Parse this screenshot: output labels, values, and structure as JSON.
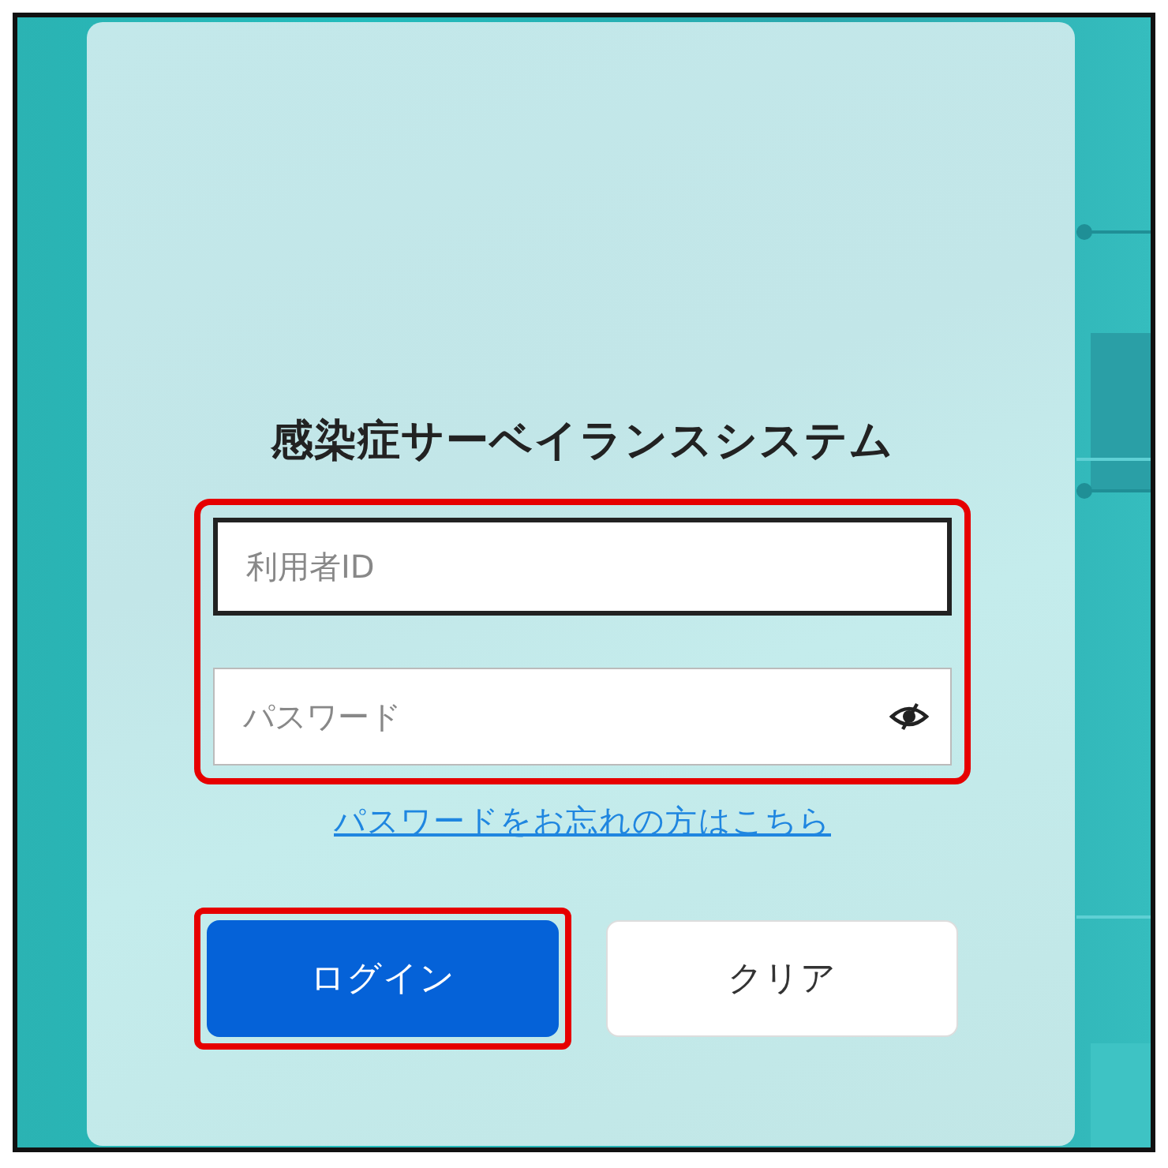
{
  "title": "感染症サーベイランスシステム",
  "login_form": {
    "highlighted": true,
    "fields": [
      {
        "kind": "text",
        "placeholder": "利用者ID",
        "focused": true
      },
      {
        "kind": "password",
        "placeholder": "パスワード",
        "focused": false
      }
    ]
  },
  "forgot_link": "パスワードをお忘れの方はこちら",
  "buttons": [
    {
      "label": "ログイン",
      "kind": "primary",
      "highlighted": true
    },
    {
      "label": "クリア",
      "kind": "secondary",
      "highlighted": false
    }
  ]
}
